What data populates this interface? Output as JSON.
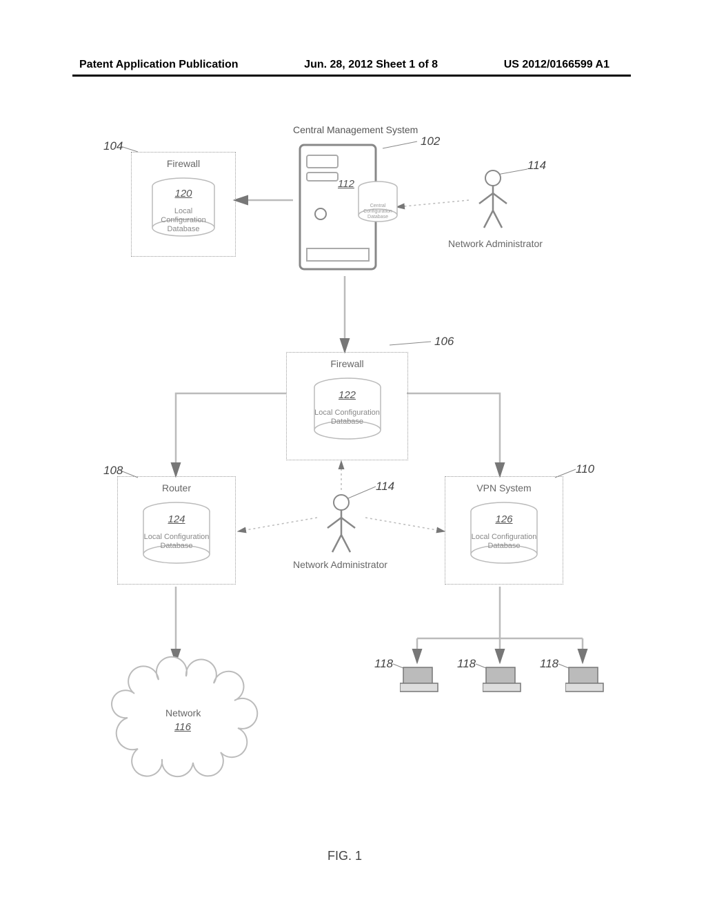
{
  "header": {
    "left": "Patent Application Publication",
    "mid": "Jun. 28, 2012  Sheet 1 of 8",
    "right": "US 2012/0166599 A1"
  },
  "cms": {
    "title": "Central Management System",
    "dbref": "112",
    "dblabel": "Central Configuration Database",
    "ref": "102"
  },
  "fw1": {
    "title": "Firewall",
    "ref": "104",
    "dbref": "120",
    "dblabel": "Local Configuration Database"
  },
  "fw2": {
    "title": "Firewall",
    "ref": "106",
    "dbref": "122",
    "dblabel": "Local Configuration Database"
  },
  "router": {
    "title": "Router",
    "ref": "108",
    "dbref": "124",
    "dblabel": "Local Configuration Database"
  },
  "vpn": {
    "title": "VPN System",
    "ref": "110",
    "dbref": "126",
    "dblabel": "Local Configuration Database"
  },
  "admin": {
    "label": "Network Administrator",
    "ref": "114"
  },
  "network": {
    "label": "Network",
    "ref": "116"
  },
  "client_ref": "118",
  "figure": "FIG. 1"
}
